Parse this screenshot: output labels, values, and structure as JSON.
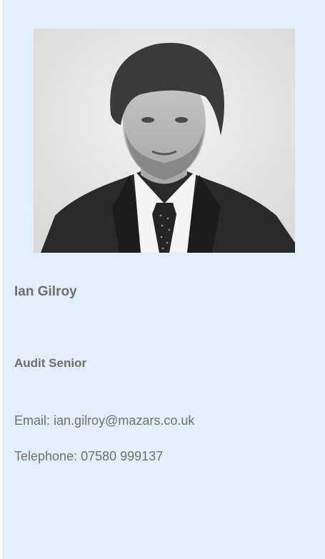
{
  "profile": {
    "photo_icon": "person-portrait",
    "name": "Ian Gilroy",
    "title": "Audit Senior",
    "email_label": "Email:",
    "email": "ian.gilroy@mazars.co.uk",
    "telephone_label": "Telephone:",
    "telephone": "07580 999137"
  },
  "colors": {
    "card_background": "#e2eef8",
    "text": "#6e6e6e"
  }
}
